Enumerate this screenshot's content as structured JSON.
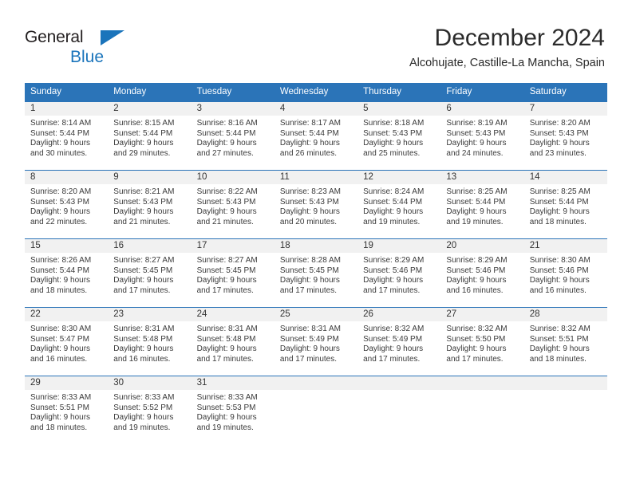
{
  "brand": {
    "name_part1": "General",
    "name_part2": "Blue",
    "triangle_color": "#1a74bb"
  },
  "header": {
    "title": "December 2024",
    "subtitle": "Alcohujate, Castille-La Mancha, Spain"
  },
  "theme": {
    "header_bg": "#2b74b8",
    "daynum_bg": "#f1f1f1",
    "text": "#3a3a3a"
  },
  "weekday_headers": [
    "Sunday",
    "Monday",
    "Tuesday",
    "Wednesday",
    "Thursday",
    "Friday",
    "Saturday"
  ],
  "weeks": [
    [
      {
        "day": "1",
        "sunrise": "Sunrise: 8:14 AM",
        "sunset": "Sunset: 5:44 PM",
        "daylight_line1": "Daylight: 9 hours",
        "daylight_line2": "and 30 minutes."
      },
      {
        "day": "2",
        "sunrise": "Sunrise: 8:15 AM",
        "sunset": "Sunset: 5:44 PM",
        "daylight_line1": "Daylight: 9 hours",
        "daylight_line2": "and 29 minutes."
      },
      {
        "day": "3",
        "sunrise": "Sunrise: 8:16 AM",
        "sunset": "Sunset: 5:44 PM",
        "daylight_line1": "Daylight: 9 hours",
        "daylight_line2": "and 27 minutes."
      },
      {
        "day": "4",
        "sunrise": "Sunrise: 8:17 AM",
        "sunset": "Sunset: 5:44 PM",
        "daylight_line1": "Daylight: 9 hours",
        "daylight_line2": "and 26 minutes."
      },
      {
        "day": "5",
        "sunrise": "Sunrise: 8:18 AM",
        "sunset": "Sunset: 5:43 PM",
        "daylight_line1": "Daylight: 9 hours",
        "daylight_line2": "and 25 minutes."
      },
      {
        "day": "6",
        "sunrise": "Sunrise: 8:19 AM",
        "sunset": "Sunset: 5:43 PM",
        "daylight_line1": "Daylight: 9 hours",
        "daylight_line2": "and 24 minutes."
      },
      {
        "day": "7",
        "sunrise": "Sunrise: 8:20 AM",
        "sunset": "Sunset: 5:43 PM",
        "daylight_line1": "Daylight: 9 hours",
        "daylight_line2": "and 23 minutes."
      }
    ],
    [
      {
        "day": "8",
        "sunrise": "Sunrise: 8:20 AM",
        "sunset": "Sunset: 5:43 PM",
        "daylight_line1": "Daylight: 9 hours",
        "daylight_line2": "and 22 minutes."
      },
      {
        "day": "9",
        "sunrise": "Sunrise: 8:21 AM",
        "sunset": "Sunset: 5:43 PM",
        "daylight_line1": "Daylight: 9 hours",
        "daylight_line2": "and 21 minutes."
      },
      {
        "day": "10",
        "sunrise": "Sunrise: 8:22 AM",
        "sunset": "Sunset: 5:43 PM",
        "daylight_line1": "Daylight: 9 hours",
        "daylight_line2": "and 21 minutes."
      },
      {
        "day": "11",
        "sunrise": "Sunrise: 8:23 AM",
        "sunset": "Sunset: 5:43 PM",
        "daylight_line1": "Daylight: 9 hours",
        "daylight_line2": "and 20 minutes."
      },
      {
        "day": "12",
        "sunrise": "Sunrise: 8:24 AM",
        "sunset": "Sunset: 5:44 PM",
        "daylight_line1": "Daylight: 9 hours",
        "daylight_line2": "and 19 minutes."
      },
      {
        "day": "13",
        "sunrise": "Sunrise: 8:25 AM",
        "sunset": "Sunset: 5:44 PM",
        "daylight_line1": "Daylight: 9 hours",
        "daylight_line2": "and 19 minutes."
      },
      {
        "day": "14",
        "sunrise": "Sunrise: 8:25 AM",
        "sunset": "Sunset: 5:44 PM",
        "daylight_line1": "Daylight: 9 hours",
        "daylight_line2": "and 18 minutes."
      }
    ],
    [
      {
        "day": "15",
        "sunrise": "Sunrise: 8:26 AM",
        "sunset": "Sunset: 5:44 PM",
        "daylight_line1": "Daylight: 9 hours",
        "daylight_line2": "and 18 minutes."
      },
      {
        "day": "16",
        "sunrise": "Sunrise: 8:27 AM",
        "sunset": "Sunset: 5:45 PM",
        "daylight_line1": "Daylight: 9 hours",
        "daylight_line2": "and 17 minutes."
      },
      {
        "day": "17",
        "sunrise": "Sunrise: 8:27 AM",
        "sunset": "Sunset: 5:45 PM",
        "daylight_line1": "Daylight: 9 hours",
        "daylight_line2": "and 17 minutes."
      },
      {
        "day": "18",
        "sunrise": "Sunrise: 8:28 AM",
        "sunset": "Sunset: 5:45 PM",
        "daylight_line1": "Daylight: 9 hours",
        "daylight_line2": "and 17 minutes."
      },
      {
        "day": "19",
        "sunrise": "Sunrise: 8:29 AM",
        "sunset": "Sunset: 5:46 PM",
        "daylight_line1": "Daylight: 9 hours",
        "daylight_line2": "and 17 minutes."
      },
      {
        "day": "20",
        "sunrise": "Sunrise: 8:29 AM",
        "sunset": "Sunset: 5:46 PM",
        "daylight_line1": "Daylight: 9 hours",
        "daylight_line2": "and 16 minutes."
      },
      {
        "day": "21",
        "sunrise": "Sunrise: 8:30 AM",
        "sunset": "Sunset: 5:46 PM",
        "daylight_line1": "Daylight: 9 hours",
        "daylight_line2": "and 16 minutes."
      }
    ],
    [
      {
        "day": "22",
        "sunrise": "Sunrise: 8:30 AM",
        "sunset": "Sunset: 5:47 PM",
        "daylight_line1": "Daylight: 9 hours",
        "daylight_line2": "and 16 minutes."
      },
      {
        "day": "23",
        "sunrise": "Sunrise: 8:31 AM",
        "sunset": "Sunset: 5:48 PM",
        "daylight_line1": "Daylight: 9 hours",
        "daylight_line2": "and 16 minutes."
      },
      {
        "day": "24",
        "sunrise": "Sunrise: 8:31 AM",
        "sunset": "Sunset: 5:48 PM",
        "daylight_line1": "Daylight: 9 hours",
        "daylight_line2": "and 17 minutes."
      },
      {
        "day": "25",
        "sunrise": "Sunrise: 8:31 AM",
        "sunset": "Sunset: 5:49 PM",
        "daylight_line1": "Daylight: 9 hours",
        "daylight_line2": "and 17 minutes."
      },
      {
        "day": "26",
        "sunrise": "Sunrise: 8:32 AM",
        "sunset": "Sunset: 5:49 PM",
        "daylight_line1": "Daylight: 9 hours",
        "daylight_line2": "and 17 minutes."
      },
      {
        "day": "27",
        "sunrise": "Sunrise: 8:32 AM",
        "sunset": "Sunset: 5:50 PM",
        "daylight_line1": "Daylight: 9 hours",
        "daylight_line2": "and 17 minutes."
      },
      {
        "day": "28",
        "sunrise": "Sunrise: 8:32 AM",
        "sunset": "Sunset: 5:51 PM",
        "daylight_line1": "Daylight: 9 hours",
        "daylight_line2": "and 18 minutes."
      }
    ],
    [
      {
        "day": "29",
        "sunrise": "Sunrise: 8:33 AM",
        "sunset": "Sunset: 5:51 PM",
        "daylight_line1": "Daylight: 9 hours",
        "daylight_line2": "and 18 minutes."
      },
      {
        "day": "30",
        "sunrise": "Sunrise: 8:33 AM",
        "sunset": "Sunset: 5:52 PM",
        "daylight_line1": "Daylight: 9 hours",
        "daylight_line2": "and 19 minutes."
      },
      {
        "day": "31",
        "sunrise": "Sunrise: 8:33 AM",
        "sunset": "Sunset: 5:53 PM",
        "daylight_line1": "Daylight: 9 hours",
        "daylight_line2": "and 19 minutes."
      },
      {
        "day": "",
        "sunrise": "",
        "sunset": "",
        "daylight_line1": "",
        "daylight_line2": ""
      },
      {
        "day": "",
        "sunrise": "",
        "sunset": "",
        "daylight_line1": "",
        "daylight_line2": ""
      },
      {
        "day": "",
        "sunrise": "",
        "sunset": "",
        "daylight_line1": "",
        "daylight_line2": ""
      },
      {
        "day": "",
        "sunrise": "",
        "sunset": "",
        "daylight_line1": "",
        "daylight_line2": ""
      }
    ]
  ]
}
